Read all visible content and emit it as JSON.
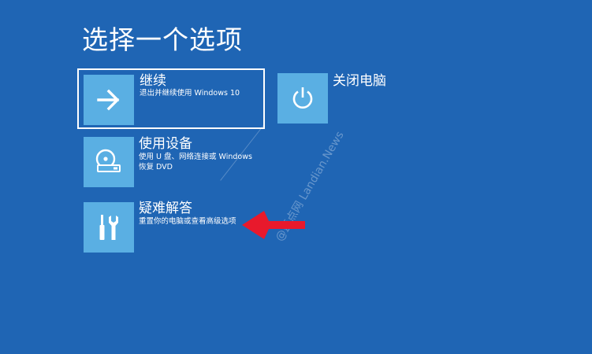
{
  "page": {
    "title": "选择一个选项"
  },
  "options": {
    "continue": {
      "title": "继续",
      "description": "退出并继续使用 Windows 10",
      "icon": "arrow-right-icon"
    },
    "shutdown": {
      "title": "关闭电脑",
      "icon": "power-icon"
    },
    "use_device": {
      "title": "使用设备",
      "description": "使用 U 盘、网络连接或 Windows 恢复 DVD",
      "icon": "disc-drive-icon"
    },
    "troubleshoot": {
      "title": "疑难解答",
      "description": "重置你的电脑或查看高级选项",
      "icon": "tools-icon"
    }
  },
  "watermark": {
    "text": "@蓝点网 Landian.News"
  },
  "colors": {
    "background": "#1f65b4",
    "tile": "#5aafe3",
    "annotation": "#e8192c"
  }
}
